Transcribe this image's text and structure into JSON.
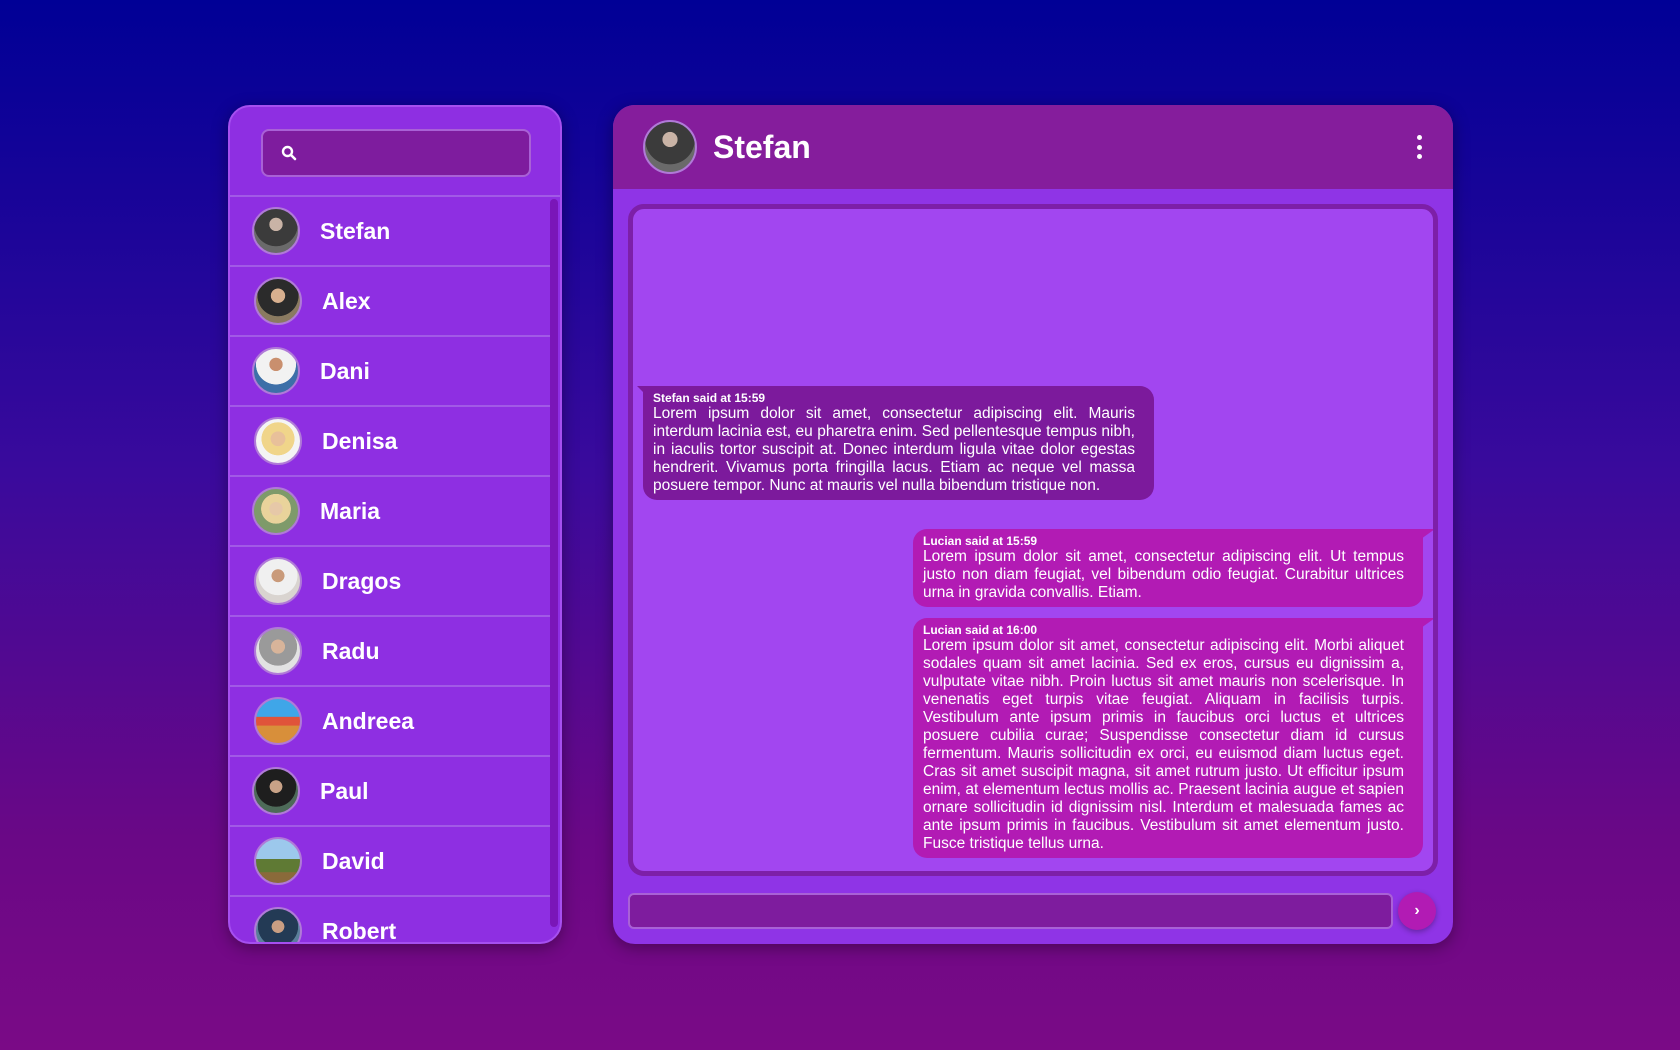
{
  "search": {
    "placeholder": "",
    "value": ""
  },
  "contacts": [
    {
      "name": "Stefan",
      "avatar": "person-photo"
    },
    {
      "name": "Alex",
      "avatar": "person-photo"
    },
    {
      "name": "Dani",
      "avatar": "person-photo"
    },
    {
      "name": "Denisa",
      "avatar": "person-photo"
    },
    {
      "name": "Maria",
      "avatar": "person-photo"
    },
    {
      "name": "Dragos",
      "avatar": "person-photo"
    },
    {
      "name": "Radu",
      "avatar": "person-photo"
    },
    {
      "name": "Andreea",
      "avatar": "landscape-photo"
    },
    {
      "name": "Paul",
      "avatar": "person-photo"
    },
    {
      "name": "David",
      "avatar": "tree-photo"
    },
    {
      "name": "Robert",
      "avatar": "person-photo"
    }
  ],
  "chat": {
    "contact_name": "Stefan",
    "menu_icon": "vertical-dots-icon",
    "messages": [
      {
        "meta": "Stefan said at 15:59",
        "text": "Lorem ipsum dolor sit amet, consectetur adipiscing elit. Mauris interdum lacinia est, eu pharetra enim. Sed pellentesque tempus nibh, in iaculis tortor suscipit at. Donec interdum ligula vitae dolor egestas hendrerit. Vivamus porta fringilla lacus. Etiam ac neque vel massa posuere tempor. Nunc at mauris vel nulla bibendum tristique non."
      },
      {
        "meta": "Lucian said at 15:59",
        "text": "Lorem ipsum dolor sit amet, consectetur adipiscing elit. Ut tempus justo non diam feugiat, vel bibendum odio feugiat. Curabitur ultrices urna in gravida convallis. Etiam."
      },
      {
        "meta": "Lucian said at 16:00",
        "text": "Lorem ipsum dolor sit amet, consectetur adipiscing elit. Morbi aliquet sodales quam sit amet lacinia. Sed ex eros, cursus eu dignissim a, vulputate vitae nibh. Proin luctus sit amet mauris non scelerisque. In venenatis eget turpis vitae feugiat. Aliquam in facilisis turpis. Vestibulum ante ipsum primis in faucibus orci luctus et ultrices posuere cubilia curae; Suspendisse consectetur diam id cursus fermentum. Mauris sollicitudin ex orci, eu euismod diam luctus eget. Cras sit amet suscipit magna, sit amet rutrum justo. Ut efficitur ipsum enim, at elementum lectus mollis ac. Praesent lacinia augue et sapien ornare sollicitudin id dignissim nisl. Interdum et malesuada fames ac ante ipsum primis in faucibus. Vestibulum sit amet elementum justo. Fusce tristique tellus urna."
      }
    ],
    "composer": {
      "placeholder": "",
      "value": ""
    },
    "send_label": "›"
  },
  "colors": {
    "panel": "#8e2fe2",
    "header": "#851d9c",
    "incoming_bubble": "#7c1a9c",
    "outgoing_bubble": "#b21bb4"
  }
}
